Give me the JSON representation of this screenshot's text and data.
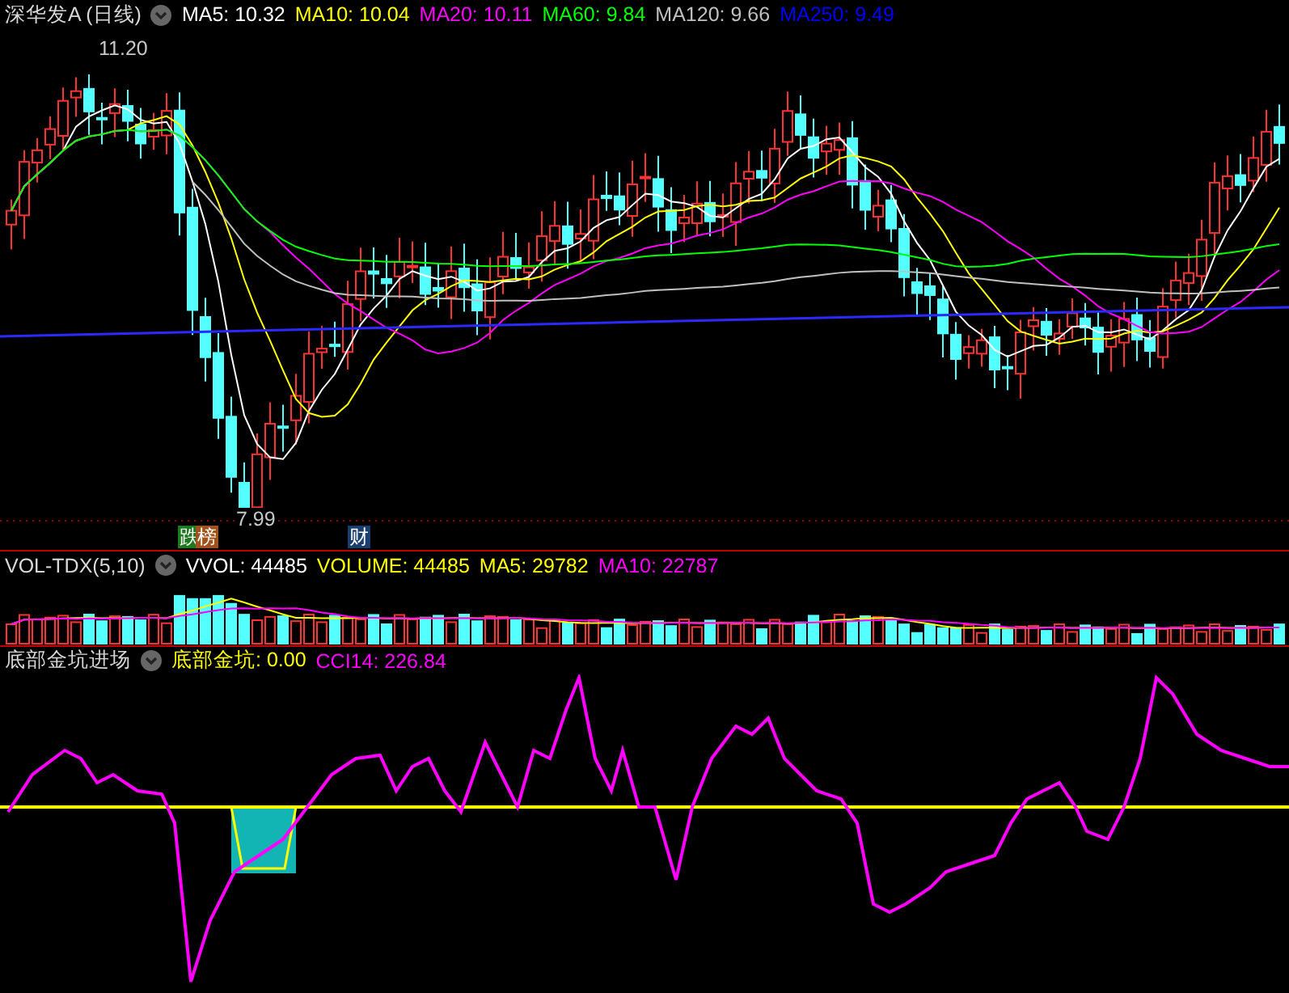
{
  "header": {
    "title": "深华发A (日线)",
    "indicators": [
      {
        "label": "MA5: 10.32",
        "color": "#ffffff"
      },
      {
        "label": "MA10: 10.04",
        "color": "#ffff00"
      },
      {
        "label": "MA20: 10.11",
        "color": "#ff00ff"
      },
      {
        "label": "MA60: 9.84",
        "color": "#00ff00"
      },
      {
        "label": "MA120: 9.66",
        "color": "#c0c0c0"
      },
      {
        "label": "MA250: 9.49",
        "color": "#0000ff"
      }
    ]
  },
  "price_panel": {
    "high_label": "11.20",
    "low_label": "7.99",
    "markers": [
      {
        "text": "跌",
        "color": "#1e7a1e"
      },
      {
        "text": "榜",
        "color": "#a0521a"
      },
      {
        "text": "财",
        "color": "#1a3f6e"
      }
    ]
  },
  "volume_panel": {
    "title": "VOL-TDX(5,10)",
    "indicators": [
      {
        "label": "VVOL: 44485",
        "color": "#ffffff"
      },
      {
        "label": "VOLUME: 44485",
        "color": "#ffff00"
      },
      {
        "label": "MA5: 29782",
        "color": "#ffff00"
      },
      {
        "label": "MA10: 22787",
        "color": "#ff00ff"
      }
    ]
  },
  "cci_panel": {
    "title": "底部金坑进场",
    "indicators": [
      {
        "label": "底部金坑: 0.00",
        "color": "#ffff00"
      },
      {
        "label": "CCI14: 226.84",
        "color": "#ff00ff"
      }
    ]
  }
}
